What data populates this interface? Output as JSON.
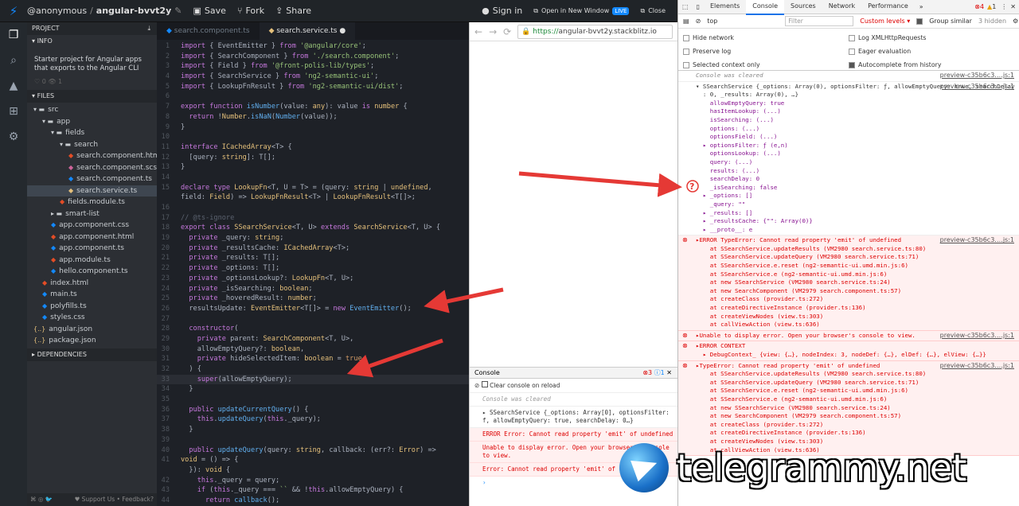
{
  "topbar": {
    "user": "@anonymous",
    "sep": "/",
    "project": "angular-bvvt2y",
    "save": "Save",
    "fork": "Fork",
    "share": "Share",
    "signin": "Sign in",
    "open_new": "Open in New Window",
    "live": "LIVE",
    "close": "Close"
  },
  "sidebar": {
    "project_header": "PROJECT",
    "info_header": "INFO",
    "info_text": "Starter project for Angular apps that exports to the Angular CLI",
    "counts": "♡ 0   👁 1",
    "files_header": "FILES",
    "deps_header": "DEPENDENCIES",
    "footer_left": "⌘ ◎ 🐦",
    "footer_right": "♥ Support Us • Feedback?",
    "files": [
      {
        "name": "src",
        "indent": 0,
        "icon": "▾ ▬",
        "color": "#c8ccd0"
      },
      {
        "name": "app",
        "indent": 1,
        "icon": "▾ ▬",
        "color": "#c8ccd0"
      },
      {
        "name": "fields",
        "indent": 2,
        "icon": "▾ ▬",
        "color": "#c8ccd0"
      },
      {
        "name": "search",
        "indent": 3,
        "icon": "▾ ▬",
        "color": "#c8ccd0"
      },
      {
        "name": "search.component.html",
        "indent": 4,
        "icon": "◆",
        "color": "#e44d26"
      },
      {
        "name": "search.component.scss",
        "indent": 4,
        "icon": "◆",
        "color": "#cf649a"
      },
      {
        "name": "search.component.ts",
        "indent": 4,
        "icon": "◆",
        "color": "#1389fd"
      },
      {
        "name": "search.service.ts",
        "indent": 4,
        "icon": "◆",
        "color": "#e5c07b",
        "selected": true
      },
      {
        "name": "fields.module.ts",
        "indent": 3,
        "icon": "◆",
        "color": "#e44d26"
      },
      {
        "name": "smart-list",
        "indent": 2,
        "icon": "▸ ▬",
        "color": "#c8ccd0"
      },
      {
        "name": "app.component.css",
        "indent": 2,
        "icon": "◆",
        "color": "#1389fd"
      },
      {
        "name": "app.component.html",
        "indent": 2,
        "icon": "◆",
        "color": "#e44d26"
      },
      {
        "name": "app.component.ts",
        "indent": 2,
        "icon": "◆",
        "color": "#1389fd"
      },
      {
        "name": "app.module.ts",
        "indent": 2,
        "icon": "◆",
        "color": "#e44d26"
      },
      {
        "name": "hello.component.ts",
        "indent": 2,
        "icon": "◆",
        "color": "#1389fd"
      },
      {
        "name": "index.html",
        "indent": 1,
        "icon": "◆",
        "color": "#e44d26"
      },
      {
        "name": "main.ts",
        "indent": 1,
        "icon": "◆",
        "color": "#1389fd"
      },
      {
        "name": "polyfills.ts",
        "indent": 1,
        "icon": "◆",
        "color": "#1389fd"
      },
      {
        "name": "styles.css",
        "indent": 1,
        "icon": "◆",
        "color": "#1389fd"
      },
      {
        "name": "angular.json",
        "indent": 0,
        "icon": "{..}",
        "color": "#e5c07b"
      },
      {
        "name": "package.json",
        "indent": 0,
        "icon": "{..}",
        "color": "#e5c07b"
      }
    ]
  },
  "editor": {
    "tabs": [
      "search.component.ts",
      "search.service.ts"
    ],
    "lines": [
      "<span class=k>import</span> { SearchComponent } <span class=k>from</span> <span class=s>'./search.component'</span>;",
      "<span class=k>import</span> { Field } <span class=k>from</span> <span class=s>'@front-polis-lib/types'</span>;",
      "<span class=k>import</span> { SearchService } <span class=k>from</span> <span class=s>'ng2-semantic-ui'</span>;",
      "<span class=k>import</span> { LookupFnResult } <span class=k>from</span> <span class=s>'ng2-semantic-ui/dist'</span>;",
      "",
      "<span class=k>export function</span> <span class=f>isNumber</span>(value: <span class=ty>any</span>): value <span class=k>is</span> <span class=ty>number</span> {",
      "  <span class=k>return</span> !<span class=ty>Number</span>.<span class=f>isNaN</span>(<span class=f>Number</span>(value));",
      "}",
      "",
      "<span class=k>interface</span> <span class=ty>ICachedArray</span>&lt;T&gt; {",
      "  [query: <span class=ty>string</span>]: T[];",
      "}",
      "",
      "<span class=k>declare type</span> <span class=ty>LookupFn</span>&lt;T, U = T&gt; = (query: <span class=ty>string</span> | <span class=ty>undefined</span>,",
      "field: <span class=ty>Field</span>) =&gt; <span class=ty>LookupFnResult</span>&lt;T&gt; | <span class=ty>LookupFnResult</span>&lt;T[]&gt;;",
      "",
      "<span class=c>// @ts-ignore</span>",
      "<span class=k>export class</span> <span class=ty>SSearchService</span>&lt;T, U&gt; <span class=k>extends</span> <span class=ty>SearchService</span>&lt;T, U&gt; {",
      "  <span class=k>private</span> _query: <span class=ty>string</span>;",
      "  <span class=k>private</span> _resultsCache: <span class=ty>ICachedArray</span>&lt;T&gt;;",
      "  <span class=k>private</span> _results: T[];",
      "  <span class=k>private</span> _options: T[];",
      "  <span class=k>private</span> _optionsLookup?: <span class=ty>LookupFn</span>&lt;T, U&gt;;",
      "  <span class=k>private</span> _isSearching: <span class=ty>boolean</span>;",
      "  <span class=k>private</span> _hoveredResult: <span class=ty>number</span>;",
      "  resultsUpdate: <span class=ty>EventEmitter</span>&lt;T[]&gt; = <span class=k>new</span> <span class=f>EventEmitter</span>();",
      "",
      "  <span class=k>constructor</span>(",
      "    <span class=k>private</span> parent: <span class=ty>SearchComponent</span>&lt;T, U&gt;,",
      "    allowEmptyQuery?: <span class=ty>boolean</span>,",
      "    <span class=k>private</span> hideSelectedItem: <span class=ty>boolean</span> = <span class=n>true</span>",
      "  ) {",
      "    <span class=k>super</span>(allowEmptyQuery);",
      "  }",
      "",
      "  <span class=k>public</span> <span class=f>updateCurrentQuery</span>() {",
      "    <span class=k>this</span>.<span class=f>updateQuery</span>(<span class=k>this</span>._query);",
      "  }",
      "",
      "  <span class=k>public</span> <span class=f>updateQuery</span>(query: <span class=ty>string</span>, callback: (err?: <span class=ty>Error</span>) =&gt;",
      "<span class=ty>void</span> = () =&gt; {",
      "  }): <span class=ty>void</span> {",
      "    <span class=k>this</span>._query = query;",
      "    <span class=k>if</span> (<span class=k>this</span>._query === <span class=s>``</span> &amp;&amp; !<span class=k>this</span>.allowEmptyQuery) {",
      "      <span class=k>return</span> <span class=f>callback</span>();"
    ],
    "first_line_html": "<span class=k>import</span> { EventEmitter } <span class=k>from</span> <span class=s>'@angular/core'</span>;",
    "numbers": [
      "1",
      "2",
      "3",
      "4",
      "5",
      "6",
      "7",
      "8",
      "9",
      "10",
      "11",
      "12",
      "13",
      "14",
      "15",
      "",
      "16",
      "17",
      "18",
      "19",
      "20",
      "21",
      "22",
      "23",
      "24",
      "25",
      "26",
      "27",
      "28",
      "29",
      "30",
      "31",
      "32",
      "33",
      "34",
      "35",
      "36",
      "37",
      "38",
      "39",
      "40",
      "41",
      "",
      "42",
      "43",
      "44",
      "45"
    ]
  },
  "browser": {
    "url_secure": "https://",
    "url": "angular-bvvt2y.stackblitz.io",
    "console_title": "Console",
    "err_count": "3",
    "info_count": "1",
    "clear_on_reload": "Clear console on reload",
    "rows": [
      {
        "t": "Console was cleared",
        "cls": "gray"
      },
      {
        "t": "▸ SSearchService {_options: Array[0], optionsFilter: f, allowEmptyQuery: true, searchDelay: 0…}",
        "cls": ""
      },
      {
        "t": "ERROR Error: Cannot read property 'emit' of undefined",
        "cls": "err"
      },
      {
        "t": "Unable to display error. Open your browser's console to view.",
        "cls": "err"
      },
      {
        "t": "Error: Cannot read property 'emit' of undefined",
        "cls": "err"
      }
    ],
    "prompt": "›"
  },
  "devtools": {
    "tabs": [
      "Elements",
      "Console",
      "Sources",
      "Network",
      "Performance"
    ],
    "active_tab": "Console",
    "errors": "4",
    "warnings": "1",
    "context": "top",
    "filter_placeholder": "Filter",
    "levels": "Custom levels ▾",
    "group_similar": "Group similar",
    "hidden": "3 hidden",
    "options": [
      {
        "l": "Hide network",
        "on": false
      },
      {
        "l": "Log XMLHttpRequests",
        "on": false
      },
      {
        "l": "Preserve log",
        "on": false
      },
      {
        "l": "Eager evaluation",
        "on": false
      },
      {
        "l": "Selected context only",
        "on": false
      },
      {
        "l": "Autocomplete from history",
        "on": true
      }
    ],
    "src": "preview-c35b6c3….js:1",
    "log": [
      {
        "b": [
          {
            "t": "Console was cleared",
            "c": "gi",
            "s": true
          }
        ]
      },
      {
        "b": [
          {
            "t": "",
            "c": "pl",
            "s": true
          },
          {
            "t": "▾ SSearchService {_options: Array(0), optionsFilter: ƒ, allowEmptyQuery: true, searchDelay",
            "c": "pl"
          },
          {
            "t": "  : 0, _results: Array(0), …}",
            "c": "pl"
          },
          {
            "t": "    allowEmptyQuery: true",
            "c": ""
          },
          {
            "t": "    hasItemLookup: (...)",
            "c": ""
          },
          {
            "t": "    isSearching: (...)",
            "c": ""
          },
          {
            "t": "    options: (...)",
            "c": ""
          },
          {
            "t": "    optionsField: (...)",
            "c": ""
          },
          {
            "t": "  ▸ optionsFilter: ƒ (e,n)",
            "c": ""
          },
          {
            "t": "    optionsLookup: (...)",
            "c": ""
          },
          {
            "t": "    query: (...)",
            "c": ""
          },
          {
            "t": "    results: (...)",
            "c": ""
          },
          {
            "t": "    searchDelay: 0",
            "c": ""
          },
          {
            "t": "    _isSearching: false",
            "c": ""
          },
          {
            "t": "  ▸ _options: []",
            "c": ""
          },
          {
            "t": "    _query: \"\"",
            "c": ""
          },
          {
            "t": "  ▸ _results: []",
            "c": ""
          },
          {
            "t": "  ▸ _resultsCache: {\"\": Array(0)}",
            "c": ""
          },
          {
            "t": "  ▸ __proto__: e",
            "c": ""
          }
        ]
      },
      {
        "e": true,
        "b": [
          {
            "t": "▸ERROR TypeError: Cannot read property 'emit' of undefined",
            "c": "er",
            "s": true
          },
          {
            "t": "    at SSearchService.updateResults (VM2980 search.service.ts:80)",
            "c": "er"
          },
          {
            "t": "    at SSearchService.updateQuery (VM2980 search.service.ts:71)",
            "c": "er"
          },
          {
            "t": "    at SSearchService.e.reset (ng2-semantic-ui.umd.min.js:6)",
            "c": "er"
          },
          {
            "t": "    at SSearchService.e (ng2-semantic-ui.umd.min.js:6)",
            "c": "er"
          },
          {
            "t": "    at new SSearchService (VM2980 search.service.ts:24)",
            "c": "er"
          },
          {
            "t": "    at new SearchComponent (VM2979 search.component.ts:57)",
            "c": "er"
          },
          {
            "t": "    at createClass (provider.ts:272)",
            "c": "er"
          },
          {
            "t": "    at createDirectiveInstance (provider.ts:136)",
            "c": "er"
          },
          {
            "t": "    at createViewNodes (view.ts:303)",
            "c": "er"
          },
          {
            "t": "    at callViewAction (view.ts:636)",
            "c": "er"
          }
        ]
      },
      {
        "e": true,
        "b": [
          {
            "t": "▸Unable to display error. Open your browser's console to view.",
            "c": "er",
            "s": true
          }
        ]
      },
      {
        "e": true,
        "b": [
          {
            "t": "▸ERROR CONTEXT",
            "c": "er"
          },
          {
            "t": "  ▸ DebugContext_ {view: {…}, nodeIndex: 3, nodeDef: {…}, elDef: {…}, elView: {…}}",
            "c": "er"
          }
        ]
      },
      {
        "e": true,
        "b": [
          {
            "t": "▸TypeError: Cannot read property 'emit' of undefined",
            "c": "er",
            "s": true
          },
          {
            "t": "    at SSearchService.updateResults (VM2980 search.service.ts:80)",
            "c": "er"
          },
          {
            "t": "    at SSearchService.updateQuery (VM2980 search.service.ts:71)",
            "c": "er"
          },
          {
            "t": "    at SSearchService.e.reset (ng2-semantic-ui.umd.min.js:6)",
            "c": "er"
          },
          {
            "t": "    at SSearchService.e (ng2-semantic-ui.umd.min.js:6)",
            "c": "er"
          },
          {
            "t": "    at new SSearchService (VM2980 search.service.ts:24)",
            "c": "er"
          },
          {
            "t": "    at new SearchComponent (VM2979 search.component.ts:57)",
            "c": "er"
          },
          {
            "t": "    at createClass (provider.ts:272)",
            "c": "er"
          },
          {
            "t": "    at createDirectiveInstance (provider.ts:136)",
            "c": "er"
          },
          {
            "t": "    at createViewNodes (view.ts:303)",
            "c": "er"
          },
          {
            "t": "    at callViewAction (view.ts:636)",
            "c": "er"
          }
        ]
      }
    ]
  },
  "watermark": "telegrammy.net",
  "colors": {
    "accent": "#1389fd",
    "arrow": "#e53935"
  }
}
